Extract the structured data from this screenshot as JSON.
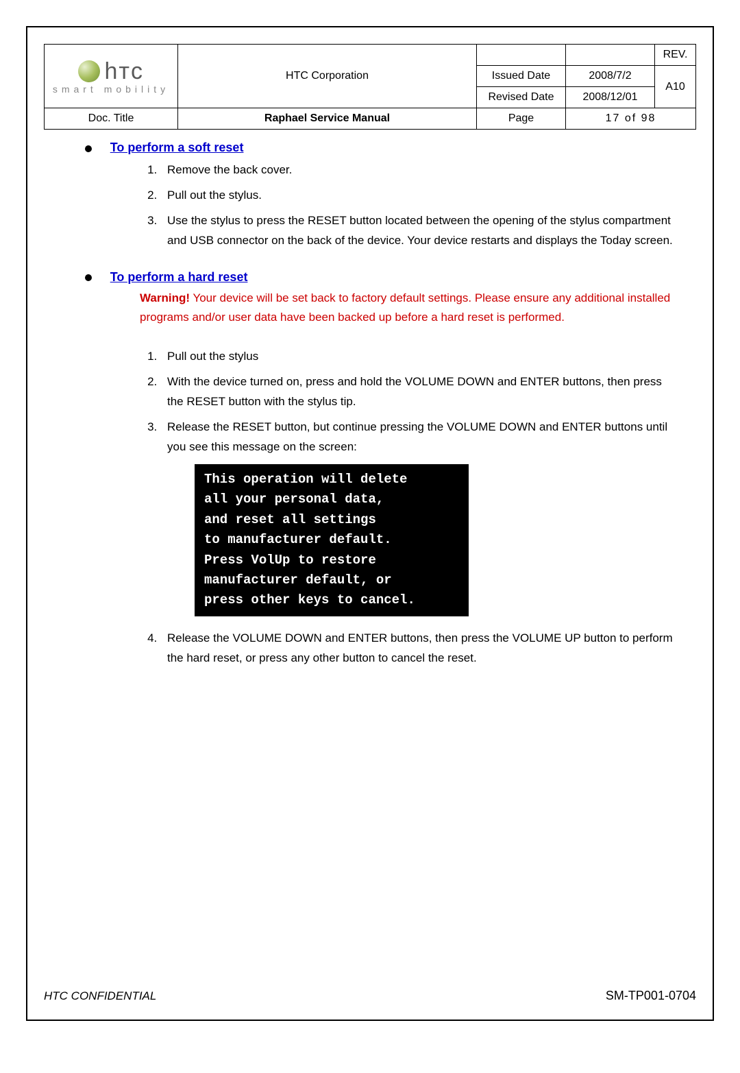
{
  "header": {
    "logo_tagline": "smart mobility",
    "company": "HTC Corporation",
    "issued_date_label": "Issued Date",
    "issued_date_value": "2008/7/2",
    "revised_date_label": "Revised Date",
    "revised_date_value": "2008/12/01",
    "rev_label": "REV.",
    "rev_value": "A10",
    "doc_title_label": "Doc. Title",
    "doc_title_value": "Raphael Service Manual",
    "page_label": "Page",
    "page_value": "17  of  98"
  },
  "sections": {
    "soft_reset_heading": "To perform a soft reset",
    "soft_reset_steps": [
      "Remove the back cover.",
      "Pull out the stylus.",
      "Use the stylus to press the RESET button located between the opening of the stylus compartment and USB connector on the back of the device. Your device restarts and displays the Today screen."
    ],
    "hard_reset_heading": "To perform a hard reset",
    "warning_label": "Warning!",
    "warning_text": " Your device will be set back to factory default settings. Please ensure any additional installed programs and/or user data have been backed up before a hard reset is performed.",
    "hard_reset_steps": [
      "Pull out the stylus",
      "With the device turned on, press and hold the VOLUME DOWN and ENTER buttons, then press the RESET button with the stylus tip.",
      "Release the RESET button, but continue pressing the VOLUME DOWN and ENTER buttons until you see this message on the screen:"
    ],
    "screen_message": "This operation will delete\nall your personal data,\nand reset all settings\nto manufacturer default.\nPress VolUp to restore\nmanufacturer default, or\npress other keys to cancel.",
    "hard_reset_step4": "Release the VOLUME DOWN and ENTER buttons, then press the VOLUME UP button to perform the hard reset, or press any other button to cancel the reset."
  },
  "footer": {
    "left": "HTC CONFIDENTIAL",
    "right": "SM-TP001-0704"
  }
}
